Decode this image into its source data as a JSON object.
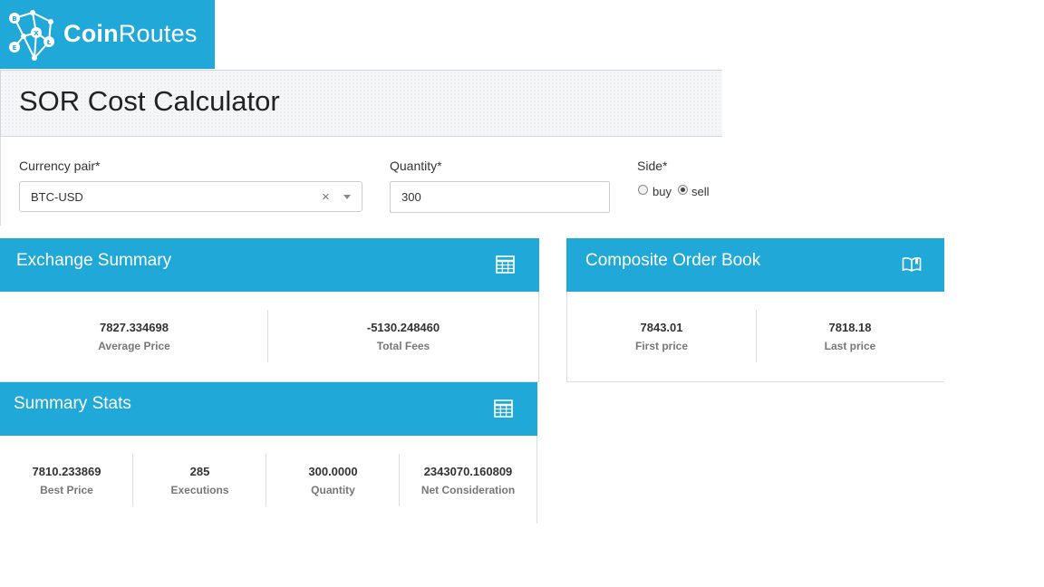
{
  "logo": {
    "brand_bold": "Coin",
    "brand_light": "Routes",
    "color": "#1fa8d8"
  },
  "page_title": "SOR Cost Calculator",
  "form": {
    "currency_pair": {
      "label": "Currency pair*",
      "value": "BTC-USD",
      "clear_glyph": "×"
    },
    "quantity": {
      "label": "Quantity*",
      "value": "300"
    },
    "side": {
      "label": "Side*",
      "options": [
        "buy",
        "sell"
      ],
      "selected": "sell"
    }
  },
  "exchange_summary": {
    "title": "Exchange Summary",
    "icon": "table-icon",
    "stats": [
      {
        "value": "7827.334698",
        "label": "Average Price"
      },
      {
        "value": "-5130.248460",
        "label": "Total Fees"
      }
    ]
  },
  "composite_order_book": {
    "title": "Composite Order Book",
    "icon": "book-icon",
    "stats": [
      {
        "value": "7843.01",
        "label": "First price"
      },
      {
        "value": "7818.18",
        "label": "Last price"
      }
    ]
  },
  "summary_stats": {
    "title": "Summary Stats",
    "icon": "table-icon",
    "stats": [
      {
        "value": "7810.233869",
        "label": "Best Price"
      },
      {
        "value": "285",
        "label": "Executions"
      },
      {
        "value": "300.0000",
        "label": "Quantity"
      },
      {
        "value": "2343070.160809",
        "label": "Net Consideration"
      }
    ]
  },
  "colors": {
    "accent": "#1fa8d8",
    "border": "#d8dde2"
  }
}
